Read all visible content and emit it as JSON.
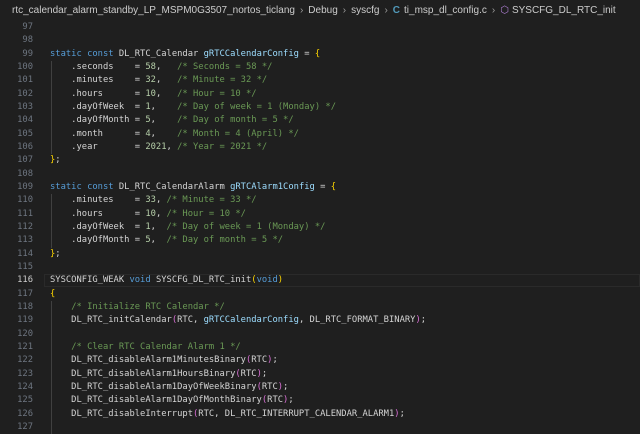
{
  "breadcrumb": {
    "items": [
      "rtc_calendar_alarm_standby_LP_MSPM0G3507_nortos_ticlang",
      "Debug",
      "syscfg",
      "ti_msp_dl_config.c",
      "SYSCFG_DL_RTC_init"
    ],
    "file_icon": "C",
    "symbol_icon": "method-cube-icon"
  },
  "editor": {
    "current_line": 116,
    "lines": [
      {
        "num": "97",
        "tokens": []
      },
      {
        "num": "98",
        "tokens": []
      },
      {
        "num": "99",
        "tokens": [
          [
            "static const ",
            "k"
          ],
          [
            "DL_RTC_Calendar ",
            "t"
          ],
          [
            "gRTCCalendarConfig",
            "v"
          ],
          [
            " = ",
            "p"
          ],
          [
            "{",
            "b"
          ]
        ]
      },
      {
        "num": "100",
        "tokens": [
          [
            "    .seconds    = ",
            "p"
          ],
          [
            "58",
            "n"
          ],
          [
            ",   ",
            "p"
          ],
          [
            "/* Seconds = 58 */",
            "c"
          ]
        ]
      },
      {
        "num": "101",
        "tokens": [
          [
            "    .minutes    = ",
            "p"
          ],
          [
            "32",
            "n"
          ],
          [
            ",   ",
            "p"
          ],
          [
            "/* Minute = 32 */",
            "c"
          ]
        ]
      },
      {
        "num": "102",
        "tokens": [
          [
            "    .hours      = ",
            "p"
          ],
          [
            "10",
            "n"
          ],
          [
            ",   ",
            "p"
          ],
          [
            "/* Hour = 10 */",
            "c"
          ]
        ]
      },
      {
        "num": "103",
        "tokens": [
          [
            "    .dayOfWeek  = ",
            "p"
          ],
          [
            "1",
            "n"
          ],
          [
            ",    ",
            "p"
          ],
          [
            "/* Day of week = 1 (Monday) */",
            "c"
          ]
        ]
      },
      {
        "num": "104",
        "tokens": [
          [
            "    .dayOfMonth = ",
            "p"
          ],
          [
            "5",
            "n"
          ],
          [
            ",    ",
            "p"
          ],
          [
            "/* Day of month = 5 */",
            "c"
          ]
        ]
      },
      {
        "num": "105",
        "tokens": [
          [
            "    .month      = ",
            "p"
          ],
          [
            "4",
            "n"
          ],
          [
            ",    ",
            "p"
          ],
          [
            "/* Month = 4 (April) */",
            "c"
          ]
        ]
      },
      {
        "num": "106",
        "tokens": [
          [
            "    .year       = ",
            "p"
          ],
          [
            "2021",
            "n"
          ],
          [
            ", ",
            "p"
          ],
          [
            "/* Year = 2021 */",
            "c"
          ]
        ]
      },
      {
        "num": "107",
        "tokens": [
          [
            "}",
            "b"
          ],
          [
            ";",
            "p"
          ]
        ]
      },
      {
        "num": "108",
        "tokens": []
      },
      {
        "num": "109",
        "tokens": [
          [
            "static const ",
            "k"
          ],
          [
            "DL_RTC_CalendarAlarm ",
            "t"
          ],
          [
            "gRTCAlarm1Config",
            "v"
          ],
          [
            " = ",
            "p"
          ],
          [
            "{",
            "b"
          ]
        ]
      },
      {
        "num": "110",
        "tokens": [
          [
            "    .minutes    = ",
            "p"
          ],
          [
            "33",
            "n"
          ],
          [
            ", ",
            "p"
          ],
          [
            "/* Minute = 33 */",
            "c"
          ]
        ]
      },
      {
        "num": "111",
        "tokens": [
          [
            "    .hours      = ",
            "p"
          ],
          [
            "10",
            "n"
          ],
          [
            ", ",
            "p"
          ],
          [
            "/* Hour = 10 */",
            "c"
          ]
        ]
      },
      {
        "num": "112",
        "tokens": [
          [
            "    .dayOfWeek  = ",
            "p"
          ],
          [
            "1",
            "n"
          ],
          [
            ",  ",
            "p"
          ],
          [
            "/* Day of week = 1 (Monday) */",
            "c"
          ]
        ]
      },
      {
        "num": "113",
        "tokens": [
          [
            "    .dayOfMonth = ",
            "p"
          ],
          [
            "5",
            "n"
          ],
          [
            ",  ",
            "p"
          ],
          [
            "/* Day of month = 5 */",
            "c"
          ]
        ]
      },
      {
        "num": "114",
        "tokens": [
          [
            "}",
            "b"
          ],
          [
            ";",
            "p"
          ]
        ]
      },
      {
        "num": "115",
        "tokens": []
      },
      {
        "num": "116",
        "tokens": [
          [
            "SYSCONFIG_WEAK ",
            "t"
          ],
          [
            "void ",
            "k"
          ],
          [
            "SYSCFG_DL_RTC_init",
            "t"
          ],
          [
            "(",
            "b"
          ],
          [
            "void",
            "k"
          ],
          [
            ")",
            "b"
          ]
        ]
      },
      {
        "num": "117",
        "tokens": [
          [
            "{",
            "b"
          ]
        ]
      },
      {
        "num": "118",
        "tokens": [
          [
            "    ",
            "p"
          ],
          [
            "/* Initialize RTC Calendar */",
            "c"
          ]
        ]
      },
      {
        "num": "119",
        "tokens": [
          [
            "    DL_RTC_initCalendar",
            "t"
          ],
          [
            "(",
            "pp"
          ],
          [
            "RTC, ",
            "p"
          ],
          [
            "gRTCCalendarConfig",
            "v"
          ],
          [
            ", DL_RTC_FORMAT_BINARY",
            "p"
          ],
          [
            ")",
            "pp"
          ],
          [
            ";",
            "p"
          ]
        ]
      },
      {
        "num": "120",
        "tokens": []
      },
      {
        "num": "121",
        "tokens": [
          [
            "    ",
            "p"
          ],
          [
            "/* Clear RTC Calendar Alarm 1 */",
            "c"
          ]
        ]
      },
      {
        "num": "122",
        "tokens": [
          [
            "    DL_RTC_disableAlarm1MinutesBinary",
            "t"
          ],
          [
            "(",
            "pp"
          ],
          [
            "RTC",
            "p"
          ],
          [
            ")",
            "pp"
          ],
          [
            ";",
            "p"
          ]
        ]
      },
      {
        "num": "123",
        "tokens": [
          [
            "    DL_RTC_disableAlarm1HoursBinary",
            "t"
          ],
          [
            "(",
            "pp"
          ],
          [
            "RTC",
            "p"
          ],
          [
            ")",
            "pp"
          ],
          [
            ";",
            "p"
          ]
        ]
      },
      {
        "num": "124",
        "tokens": [
          [
            "    DL_RTC_disableAlarm1DayOfWeekBinary",
            "t"
          ],
          [
            "(",
            "pp"
          ],
          [
            "RTC",
            "p"
          ],
          [
            ")",
            "pp"
          ],
          [
            ";",
            "p"
          ]
        ]
      },
      {
        "num": "125",
        "tokens": [
          [
            "    DL_RTC_disableAlarm1DayOfMonthBinary",
            "t"
          ],
          [
            "(",
            "pp"
          ],
          [
            "RTC",
            "p"
          ],
          [
            ")",
            "pp"
          ],
          [
            ";",
            "p"
          ]
        ]
      },
      {
        "num": "126",
        "tokens": [
          [
            "    DL_RTC_disableInterrupt",
            "t"
          ],
          [
            "(",
            "pp"
          ],
          [
            "RTC, DL_RTC_INTERRUPT_CALENDAR_ALARM1",
            "p"
          ],
          [
            ")",
            "pp"
          ],
          [
            ";",
            "p"
          ]
        ]
      },
      {
        "num": "127",
        "tokens": []
      }
    ]
  }
}
